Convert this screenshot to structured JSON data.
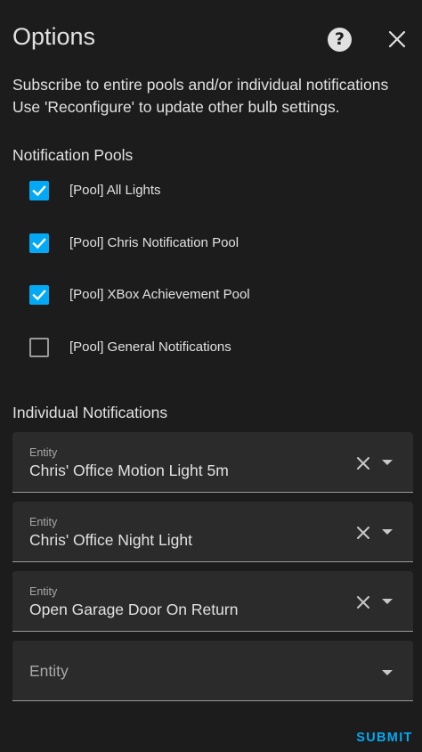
{
  "dialog": {
    "title": "Options",
    "help_icon": "help-circle-icon",
    "close_icon": "close-icon",
    "description_lines": [
      "Subscribe to entire pools and/or individual notifications",
      "Use 'Reconfigure' to update other bulb settings."
    ]
  },
  "pools": {
    "heading": "Notification Pools",
    "items": [
      {
        "label": "[Pool] All Lights",
        "checked": true
      },
      {
        "label": "[Pool] Chris Notification Pool",
        "checked": true
      },
      {
        "label": "[Pool] XBox Achievement Pool",
        "checked": true
      },
      {
        "label": "[Pool] General Notifications",
        "checked": false
      }
    ]
  },
  "individual": {
    "heading": "Individual Notifications",
    "field_label": "Entity",
    "entities": [
      {
        "value": "Chris' Office Motion Light 5m"
      },
      {
        "value": "Chris' Office Night Light"
      },
      {
        "value": "Open Garage Door On Return"
      }
    ],
    "empty_placeholder": "Entity"
  },
  "footer": {
    "submit_label": "SUBMIT"
  },
  "colors": {
    "background": "#1c1c1c",
    "field_background": "#2b2b2b",
    "accent": "#03a9f4",
    "text": "#e1e1e1",
    "secondary_text": "#a9a9a9"
  }
}
